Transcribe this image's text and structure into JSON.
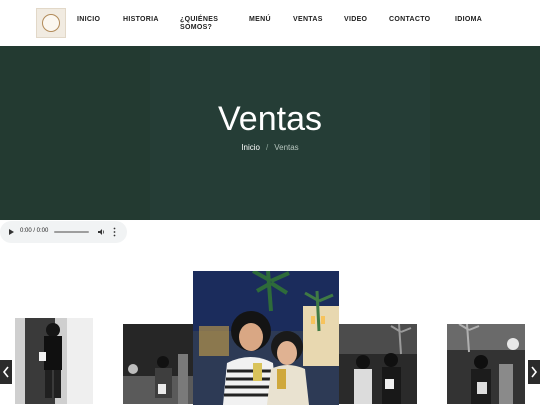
{
  "header": {
    "logo_alt": "logo",
    "nav": [
      {
        "label": "INICIO"
      },
      {
        "label": "HISTORIA"
      },
      {
        "label": "¿QUIÉNES SOMOS?"
      },
      {
        "label": "MENÚ"
      },
      {
        "label": "VENTAS"
      },
      {
        "label": "VIDEO"
      },
      {
        "label": "CONTACTO"
      },
      {
        "label": "IDIOMA"
      }
    ]
  },
  "hero": {
    "title": "Ventas",
    "breadcrumb": {
      "home": "Inicio",
      "separator": "/",
      "current": "Ventas"
    }
  },
  "audio": {
    "time": "0:00 / 0:00"
  },
  "gallery": {
    "photos": [
      {
        "name": "photo-1",
        "style": "black-and-white"
      },
      {
        "name": "photo-2",
        "style": "black-and-white"
      },
      {
        "name": "photo-3",
        "style": "color"
      },
      {
        "name": "photo-4",
        "style": "black-and-white"
      },
      {
        "name": "photo-5",
        "style": "black-and-white"
      }
    ],
    "prev_icon": "chevron-left-icon",
    "next_icon": "chevron-right-icon"
  },
  "colors": {
    "hero_bg": "#233a31",
    "text_dark": "#1d1d1d",
    "white": "#ffffff"
  }
}
